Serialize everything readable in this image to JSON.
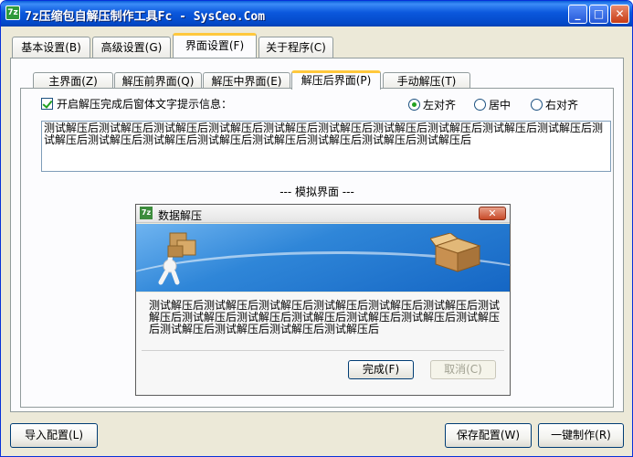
{
  "window": {
    "title": "7z压缩包自解压制作工具Fc - SysCeo.Com",
    "icon_label": "7z",
    "controls": {
      "minimize": "_",
      "maximize": "□",
      "close": "✕"
    }
  },
  "tabs": [
    {
      "label": "基本设置(B)"
    },
    {
      "label": "高级设置(G)"
    },
    {
      "label": "界面设置(F)",
      "active": true
    },
    {
      "label": "关于程序(C)"
    }
  ],
  "subtabs": [
    {
      "label": "主界面(Z)"
    },
    {
      "label": "解压前界面(Q)"
    },
    {
      "label": "解压中界面(E)"
    },
    {
      "label": "解压后界面(P)",
      "active": true
    },
    {
      "label": "手动解压(T)"
    }
  ],
  "panel": {
    "checkbox_label": "开启解压完成后窗体文字提示信息：",
    "checkbox_checked": true,
    "align_options": [
      {
        "label": "左对齐",
        "selected": true
      },
      {
        "label": "居中",
        "selected": false
      },
      {
        "label": "右对齐",
        "selected": false
      }
    ],
    "message_text": "测试解压后测试解压后测试解压后测试解压后测试解压后测试解压后测试解压后测试解压后测试解压后测试解压后测试解压后测试解压后测试解压后测试解压后测试解压后测试解压后测试解压后测试解压后",
    "sim_label": "--- 模拟界面 ---"
  },
  "dialog": {
    "icon_label": "7z",
    "title": "数据解压",
    "close": "✕",
    "message": "测试解压后测试解压后测试解压后测试解压后测试解压后测试解压后测试解压后测试解压后测试解压后测试解压后测试解压后测试解压后测试解压后测试解压后测试解压后测试解压后测试解压后",
    "ok_button": "完成(F)",
    "cancel_button": "取消(C)"
  },
  "footer": {
    "import_button": "导入配置(L)",
    "save_button": "保存配置(W)",
    "build_button": "一键制作(R)"
  }
}
